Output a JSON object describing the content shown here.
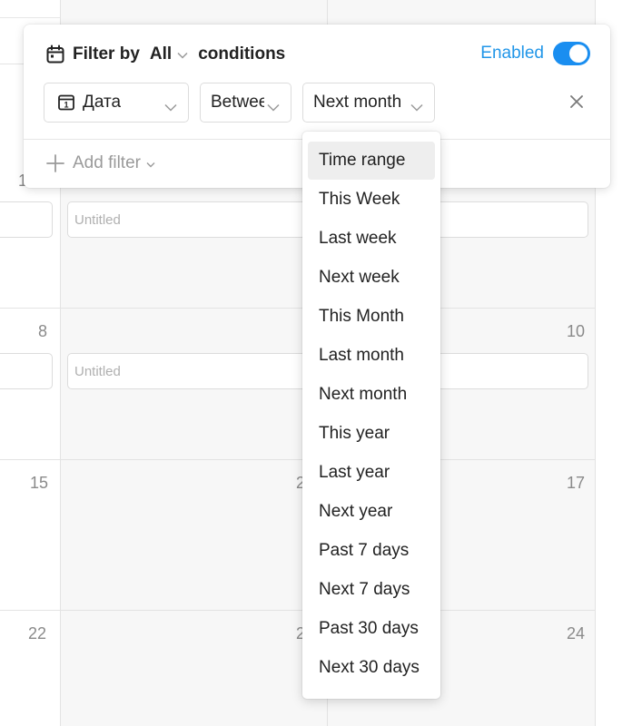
{
  "calendar": {
    "day_numbers": [
      "1",
      "8",
      "10",
      "15",
      "17",
      "22",
      "24"
    ],
    "partial_day_numbers": [
      "2",
      "2"
    ],
    "event_placeholder": "Untitled"
  },
  "filter": {
    "label": "Filter by",
    "match_mode": "All",
    "conditions_label": "conditions",
    "enabled_label": "Enabled",
    "enabled": true,
    "field": {
      "icon": "calendar-icon",
      "label": "Дата"
    },
    "operator": {
      "label": "Between"
    },
    "value": {
      "label": "Next month"
    },
    "add_filter_label": "Add filter",
    "accent_color": "#1a8ef0"
  },
  "dropdown": {
    "options": [
      "Time range",
      "This Week",
      "Last week",
      "Next week",
      "This Month",
      "Last month",
      "Next month",
      "This year",
      "Last year",
      "Next year",
      "Past 7 days",
      "Next 7 days",
      "Past 30 days",
      "Next 30 days"
    ],
    "highlighted": "Time range"
  }
}
